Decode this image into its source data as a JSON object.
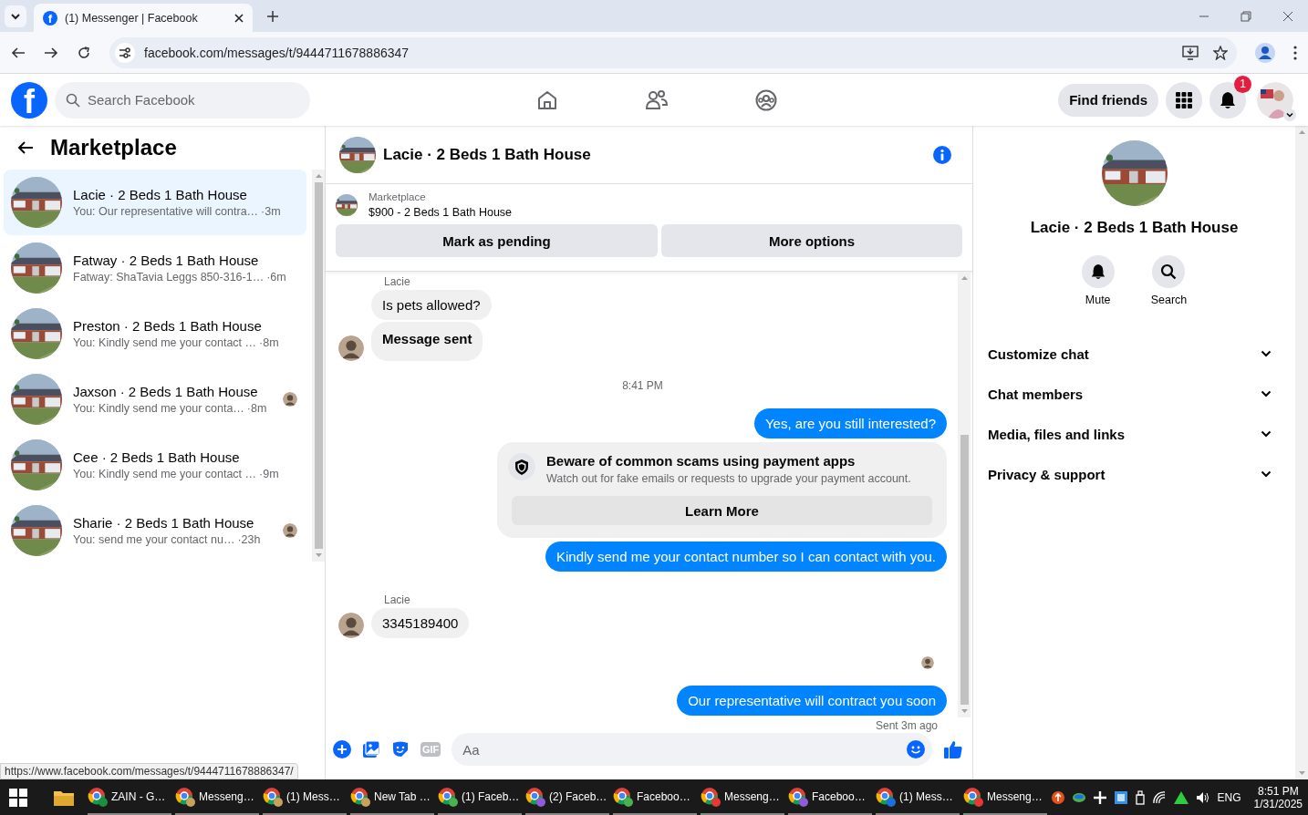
{
  "browser": {
    "tab": {
      "favicon": "f",
      "title": "(1) Messenger | Facebook"
    },
    "url": "facebook.com/messages/t/9444711678886347"
  },
  "header": {
    "logo": "f",
    "search": {
      "placeholder": "Search Facebook"
    },
    "find_friends": "Find friends",
    "notification_count": "1"
  },
  "sidebar": {
    "title": "Marketplace",
    "conversations": [
      {
        "title": "Lacie · 2 Beds 1 Bath House",
        "preview": "You: Our representative will contra…",
        "time": "·3m",
        "selected": true,
        "read_receipt": false
      },
      {
        "title": "Fatway · 2 Beds 1 Bath House",
        "preview": "Fatway: ShaTavia Leggs 850-316-1…",
        "time": "·6m",
        "selected": false,
        "read_receipt": false
      },
      {
        "title": "Preston · 2 Beds 1 Bath House",
        "preview": "You: Kindly send me your contact …",
        "time": "·8m",
        "selected": false,
        "read_receipt": false
      },
      {
        "title": "Jaxson · 2 Beds 1 Bath House",
        "preview": "You: Kindly send me your conta…",
        "time": "·8m",
        "selected": false,
        "read_receipt": true
      },
      {
        "title": "Cee · 2 Beds 1 Bath House",
        "preview": "You: Kindly send me your contact …",
        "time": "·9m",
        "selected": false,
        "read_receipt": false
      },
      {
        "title": "Sharie · 2 Beds 1 Bath House",
        "preview": "You: send me your contact nu…",
        "time": "·23h",
        "selected": false,
        "read_receipt": true
      }
    ]
  },
  "chat": {
    "title": "Lacie · 2 Beds 1 Bath House",
    "listing": {
      "source": "Marketplace",
      "title": "$900 - 2 Beds 1 Bath House"
    },
    "actions": [
      "Mark as pending",
      "More options"
    ],
    "messages": [
      {
        "kind": "sender",
        "text": "Lacie"
      },
      {
        "kind": "incoming",
        "text": "Is pets allowed?",
        "bold": false,
        "avatar": false
      },
      {
        "kind": "incoming",
        "text": "Message sent",
        "bold": true,
        "avatar": true
      },
      {
        "kind": "timestamp",
        "text": "8:41 PM"
      },
      {
        "kind": "outgoing",
        "text": "Yes, are you still interested?"
      },
      {
        "kind": "notice",
        "title": "Beware of common scams using payment apps",
        "body": "Watch out for fake emails or requests to upgrade your payment account.",
        "button": "Learn More"
      },
      {
        "kind": "outgoing",
        "text": "Kindly send me your contact number so I can contact with you."
      },
      {
        "kind": "sender",
        "text": "Lacie"
      },
      {
        "kind": "incoming",
        "text": "3345189400",
        "bold": false,
        "avatar": true
      },
      {
        "kind": "seen"
      },
      {
        "kind": "outgoing",
        "text": "Our representative will contract you soon"
      },
      {
        "kind": "status",
        "text": "Sent 3m ago"
      }
    ],
    "composer": {
      "gif": "GIF",
      "placeholder": "Aa"
    }
  },
  "details": {
    "title": "Lacie · 2 Beds 1 Bath House",
    "actions": [
      {
        "kind": "bell",
        "label": "Mute"
      },
      {
        "kind": "search",
        "label": "Search"
      }
    ],
    "sections": [
      "Customize chat",
      "Chat members",
      "Media, files and links",
      "Privacy & support"
    ]
  },
  "status_url": "https://www.facebook.com/messages/t/9444711678886347/",
  "taskbar": {
    "items": [
      {
        "label": "ZAIN - G…",
        "color": "#1e8e3e"
      },
      {
        "label": "Messeng…",
        "color": "#c8a060"
      },
      {
        "label": "(1) Mess…",
        "color": "#c8a060"
      },
      {
        "label": "New Tab …",
        "color": "#c8a060"
      },
      {
        "label": "(1) Faceb…",
        "color": "#4caf50"
      },
      {
        "label": "(2) Faceb…",
        "color": "#8e5cd9"
      },
      {
        "label": "Faceboo…",
        "color": "#4caf50"
      },
      {
        "label": "Messeng…",
        "color": "#e53935"
      },
      {
        "label": "Faceboo…",
        "color": "#8e5cd9"
      },
      {
        "label": "(1) Mess…",
        "color": "#1e6fd9"
      },
      {
        "label": "Messeng…",
        "color": "#e53935"
      }
    ],
    "language": "ENG",
    "time": "8:51 PM",
    "date": "1/31/2025"
  }
}
